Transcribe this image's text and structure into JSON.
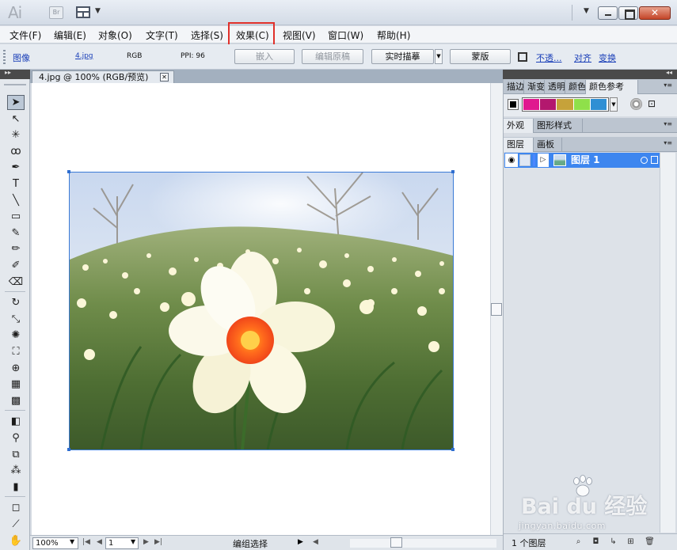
{
  "app": {
    "logo": "Ai",
    "bridge_label": "Br"
  },
  "menubar": {
    "items": [
      "文件(F)",
      "编辑(E)",
      "对象(O)",
      "文字(T)",
      "选择(S)",
      "效果(C)",
      "视图(V)",
      "窗口(W)",
      "帮助(H)"
    ],
    "highlighted": "效果(C)",
    "highlight_color": "#e0302a"
  },
  "control_bar": {
    "object_kind": "图像",
    "file_link": "4.jpg",
    "color_mode": "RGB",
    "ppi": "PPI: 96",
    "embed_label": "嵌入",
    "edit_original_label": "编辑原稿",
    "live_trace_label": "实时描摹",
    "mask_label": "蒙版",
    "opacity_label": "不透...",
    "align_label": "对齐",
    "transform_label": "变换"
  },
  "document": {
    "tab_title": "4.jpg @ 100% (RGB/预览)",
    "close_glyph": "✕"
  },
  "status_bar": {
    "zoom": "100%",
    "artboard": "1",
    "tool_status": "编组选择"
  },
  "tools": [
    {
      "name": "selection-tool-icon",
      "glyph": "➤",
      "active": true
    },
    {
      "name": "direct-selection-tool-icon",
      "glyph": "↖"
    },
    {
      "name": "magic-wand-tool-icon",
      "glyph": "✳"
    },
    {
      "name": "lasso-tool-icon",
      "glyph": "ꝏ"
    },
    {
      "name": "pen-tool-icon",
      "glyph": "✒"
    },
    {
      "name": "type-tool-icon",
      "glyph": "T"
    },
    {
      "name": "line-tool-icon",
      "glyph": "╲"
    },
    {
      "name": "rectangle-tool-icon",
      "glyph": "▭"
    },
    {
      "name": "paintbrush-tool-icon",
      "glyph": "✎"
    },
    {
      "name": "pencil-tool-icon",
      "glyph": "✏"
    },
    {
      "name": "blob-brush-tool-icon",
      "glyph": "✐"
    },
    {
      "name": "eraser-tool-icon",
      "glyph": "⌫"
    },
    {
      "name": "rotate-tool-icon",
      "glyph": "↻"
    },
    {
      "name": "scale-tool-icon",
      "glyph": "⤡"
    },
    {
      "name": "warp-tool-icon",
      "glyph": "✺"
    },
    {
      "name": "free-transform-tool-icon",
      "glyph": "⛶"
    },
    {
      "name": "shape-builder-tool-icon",
      "glyph": "⊕"
    },
    {
      "name": "perspective-grid-tool-icon",
      "glyph": "▦"
    },
    {
      "name": "mesh-tool-icon",
      "glyph": "▩"
    },
    {
      "name": "gradient-tool-icon",
      "glyph": "◧"
    },
    {
      "name": "eyedropper-tool-icon",
      "glyph": "⚲"
    },
    {
      "name": "blend-tool-icon",
      "glyph": "⧉"
    },
    {
      "name": "symbol-sprayer-tool-icon",
      "glyph": "⁂"
    },
    {
      "name": "column-graph-tool-icon",
      "glyph": "▮"
    },
    {
      "name": "artboard-tool-icon",
      "glyph": "◻"
    },
    {
      "name": "slice-tool-icon",
      "glyph": "⟋"
    },
    {
      "name": "hand-tool-icon",
      "glyph": "✋"
    }
  ],
  "right_panel": {
    "group1_tabs": [
      "描边",
      "渐变",
      "透明",
      "颜色",
      "颜色参考"
    ],
    "group2_tabs": [
      "外观",
      "图形样式"
    ],
    "group3_tabs": [
      "图层",
      "画板"
    ],
    "swatch_colors": [
      "#e0188f",
      "#b3186e",
      "#c6a23a",
      "#8fe04a",
      "#2f8fd4"
    ],
    "layer_name": "图层 1",
    "layer_count": "1 个图层",
    "layer_highlight_color": "#3d86ef"
  },
  "watermark": {
    "brand": "Bai du 经验",
    "site": "jingyan.baidu.com"
  }
}
